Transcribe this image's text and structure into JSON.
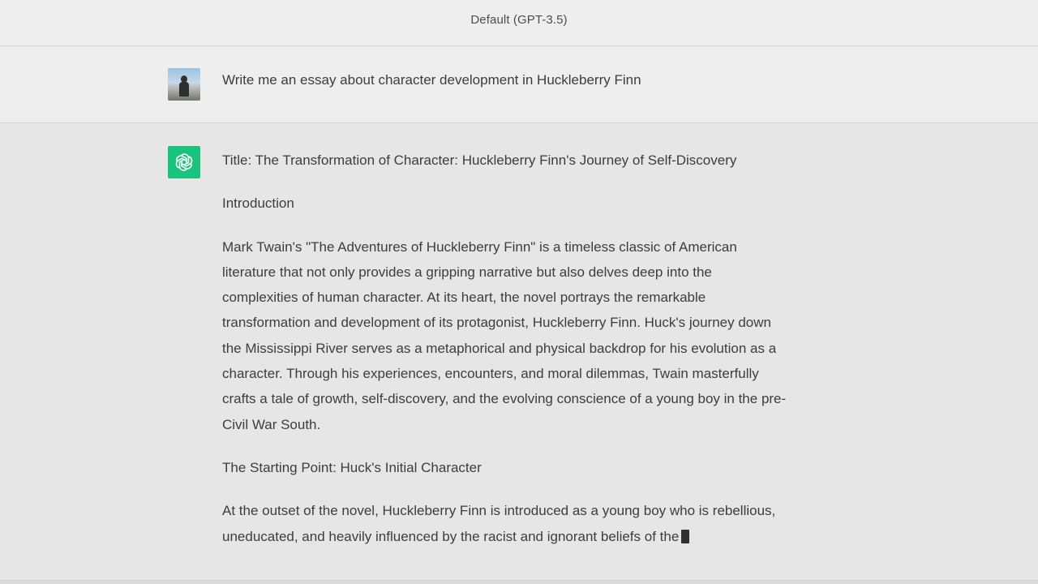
{
  "header": {
    "model_label": "Default (GPT-3.5)"
  },
  "user_message": {
    "text": "Write me an essay about character development in Huckleberry Finn"
  },
  "assistant_message": {
    "title": "Title: The Transformation of Character: Huckleberry Finn's Journey of Self-Discovery",
    "intro_heading": "Introduction",
    "intro_lines": [
      "Mark Twain's \"The Adventures of Huckleberry Finn\" is a timeless classic of American",
      "literature that not only provides a gripping narrative but also delves deep into the",
      "complexities of human character. At its heart, the novel portrays the remarkable",
      "transformation and development of its protagonist, Huckleberry Finn. Huck's journey down",
      "the Mississippi River serves as a metaphorical and physical backdrop for his evolution as a",
      "character. Through his experiences, encounters, and moral dilemmas, Twain masterfully",
      "crafts a tale of growth, self-discovery, and the evolving conscience of a young boy in the pre-",
      "Civil War South."
    ],
    "section_heading": "The Starting Point: Huck's Initial Character",
    "section_lines": [
      "At the outset of the novel, Huckleberry Finn is introduced as a young boy who is rebellious,",
      "uneducated, and heavily influenced by the racist and ignorant beliefs of the"
    ]
  },
  "colors": {
    "bot_avatar_bg": "#19c37d",
    "page_bg": "#e9eae8"
  },
  "icons": {
    "bot": "openai-logo-icon",
    "cursor": "typing-cursor"
  }
}
